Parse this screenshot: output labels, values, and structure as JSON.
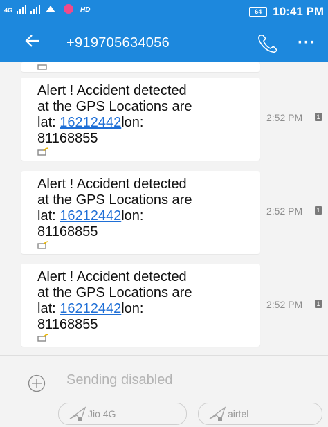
{
  "status_bar": {
    "network_tag": "4G",
    "hd_label": "HD",
    "battery": "64",
    "time": "10:41 PM"
  },
  "header": {
    "contact": "+919705634056"
  },
  "messages": [
    {
      "line1": "Alert ! Accident detected",
      "line2": "at the GPS Locations are",
      "lat_label": "lat: ",
      "lat_value": "16212442",
      "lon_label": "lon:",
      "lon_value": "81168855",
      "time": "2:52 PM",
      "sim": "1"
    },
    {
      "line1": "Alert ! Accident detected",
      "line2": "at the GPS Locations are",
      "lat_label": "lat: ",
      "lat_value": "16212442",
      "lon_label": "lon:",
      "lon_value": "81168855",
      "time": "2:52 PM",
      "sim": "1"
    },
    {
      "line1": "Alert ! Accident detected",
      "line2": "at the GPS Locations are",
      "lat_label": "lat: ",
      "lat_value": "16212442",
      "lon_label": "lon:",
      "lon_value": "81168855",
      "time": "2:52 PM",
      "sim": "1"
    }
  ],
  "composer": {
    "status": "Sending disabled",
    "sim1_label": "Jio 4G",
    "sim2_label": "airtel"
  },
  "colors": {
    "header_blue": "#1d88dd",
    "link_blue": "#1f6fd6",
    "background": "#f3f3f3"
  },
  "icons": [
    "signal-icon",
    "app-notification-icon",
    "battery-icon",
    "back-arrow-icon",
    "phone-icon",
    "more-options-icon",
    "sim-message-icon",
    "add-attachment-icon",
    "send-sim-icon"
  ]
}
